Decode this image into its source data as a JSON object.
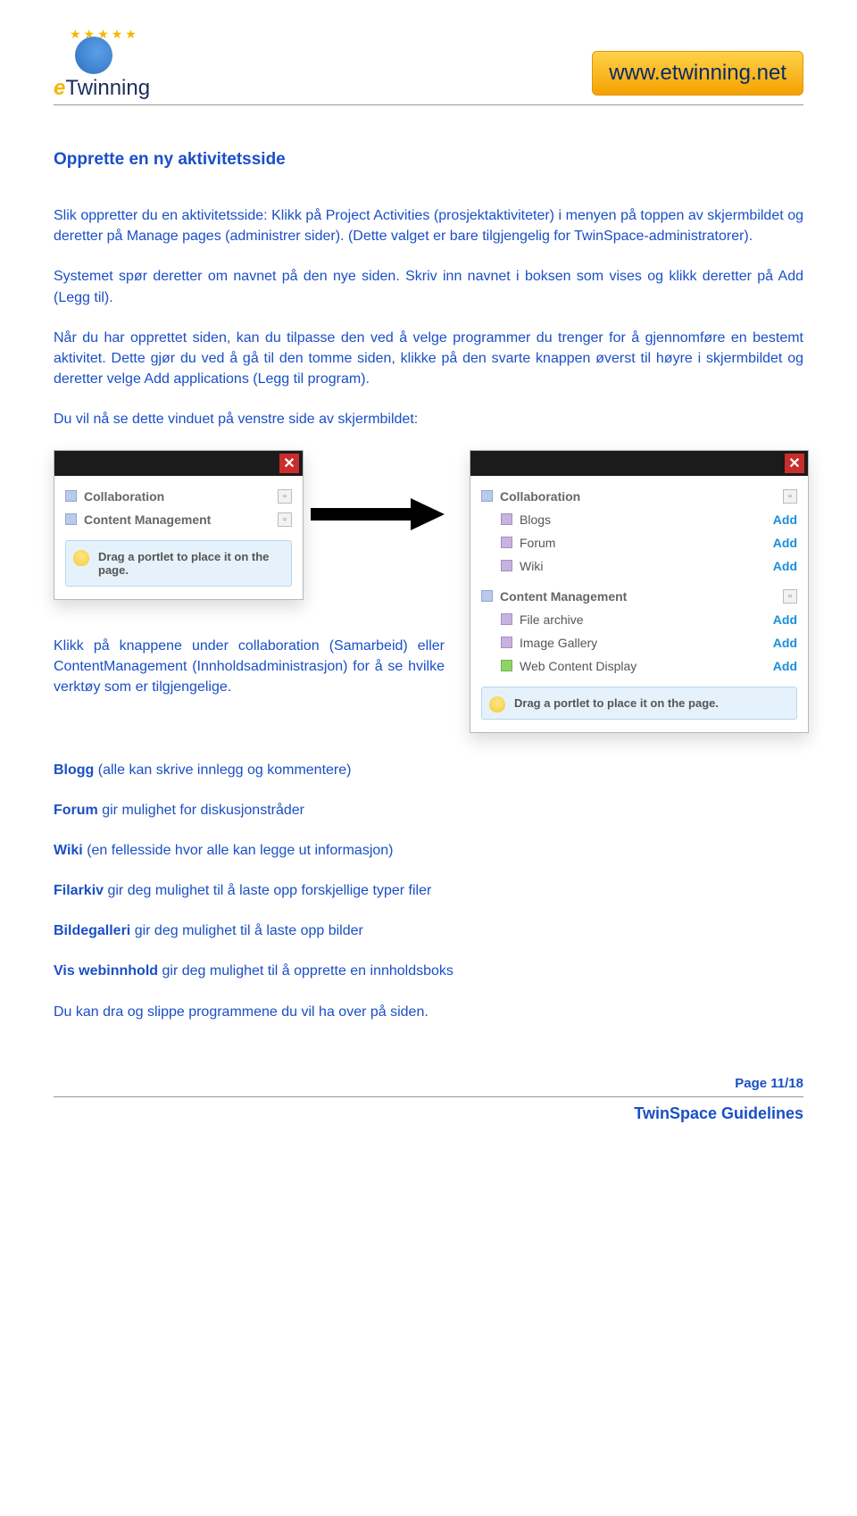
{
  "header": {
    "logo_text_prefix": "e",
    "logo_text_rest": "Twinning",
    "site_url": "www.etwinning.net"
  },
  "title": "Opprette en ny aktivitetsside",
  "para1": "Slik oppretter du en aktivitetsside: Klikk på Project Activities (prosjektaktiviteter) i menyen på toppen av skjermbildet og deretter på Manage pages (administrer sider). (Dette valget er bare tilgjengelig for TwinSpace-administratorer).",
  "para2": "Systemet spør deretter om navnet på den nye siden. Skriv inn navnet i boksen som vises og klikk deretter på Add (Legg til).",
  "para3": "Når du har opprettet siden, kan du tilpasse den ved å velge programmer du trenger for å gjennomføre en bestemt aktivitet. Dette gjør du ved å gå til den tomme siden, klikke på den svarte knappen øverst til høyre i skjermbildet og deretter velge Add applications (Legg til program).",
  "para4": "Du vil nå se dette vinduet på venstre side av skjermbildet:",
  "para5": "Klikk på knappene under collaboration (Samarbeid) eller ContentManagement (Innholdsadministrasjon) for å se hvilke verktøy som er tilgjengelige.",
  "panel_left": {
    "cat1": "Collaboration",
    "cat2": "Content Management",
    "tip": "Drag a portlet to place it on the page."
  },
  "panel_right": {
    "cat1": "Collaboration",
    "items1": [
      "Blogs",
      "Forum",
      "Wiki"
    ],
    "cat2": "Content Management",
    "items2": [
      "File archive",
      "Image Gallery",
      "Web Content Display"
    ],
    "add": "Add",
    "tip": "Drag a portlet to place it on the page."
  },
  "bullets": {
    "blog_b": "Blogg",
    "blog_t": " (alle kan skrive innlegg og kommentere)",
    "forum_b": "Forum",
    "forum_t": " gir mulighet for diskusjonstråder",
    "wiki_b": "Wiki",
    "wiki_t": " (en fellesside hvor alle kan legge ut informasjon)",
    "file_b": "Filarkiv",
    "file_t": " gir deg mulighet til å laste opp forskjellige typer filer",
    "img_b": "Bildegalleri",
    "img_t": " gir deg mulighet til å laste opp bilder",
    "web_b": "Vis webinnhold",
    "web_t": " gir deg mulighet til å opprette en innholdsboks",
    "drag": "Du kan dra og slippe programmene du vil ha over på siden."
  },
  "footer": {
    "page": "Page 11/18",
    "title": "TwinSpace Guidelines"
  }
}
